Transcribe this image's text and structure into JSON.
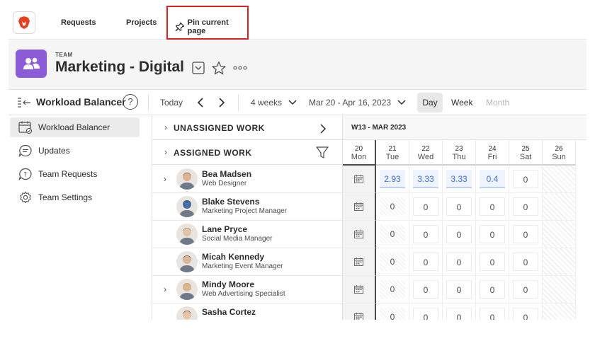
{
  "topnav": {
    "requests": "Requests",
    "projects": "Projects",
    "pin": "Pin current page",
    "logo_icon": "brave-lion-icon"
  },
  "header": {
    "label": "TEAM",
    "title": "Marketing - Digital",
    "accent": "#8b5cd6"
  },
  "toolbar": {
    "title": "Workload Balancer",
    "help": "?",
    "today": "Today",
    "range_select": "4 weeks",
    "date_range": "Mar 20 - Apr 16, 2023",
    "day": "Day",
    "week": "Week",
    "month": "Month"
  },
  "sidebar": {
    "items": [
      {
        "label": "Workload Balancer",
        "icon": "calendar-icon"
      },
      {
        "label": "Updates",
        "icon": "chat-icon"
      },
      {
        "label": "Team Requests",
        "icon": "question-bubble-icon"
      },
      {
        "label": "Team Settings",
        "icon": "gear-icon"
      }
    ]
  },
  "sections": {
    "unassigned": "UNASSIGNED WORK",
    "assigned": "ASSIGNED WORK"
  },
  "calendar": {
    "week_label": "W13 - MAR 2023",
    "days": [
      {
        "num": "20",
        "wd": "Mon"
      },
      {
        "num": "21",
        "wd": "Tue"
      },
      {
        "num": "22",
        "wd": "Wed"
      },
      {
        "num": "23",
        "wd": "Thu"
      },
      {
        "num": "24",
        "wd": "Fri"
      },
      {
        "num": "25",
        "wd": "Sat"
      },
      {
        "num": "26",
        "wd": "Sun"
      }
    ]
  },
  "people": [
    {
      "name": "Bea Madsen",
      "role": "Web Designer",
      "expandable": true,
      "values": [
        "2.93",
        "3.33",
        "3.33",
        "0.4",
        "0"
      ]
    },
    {
      "name": "Blake Stevens",
      "role": "Marketing Project Manager",
      "expandable": false,
      "values": [
        "0",
        "0",
        "0",
        "0",
        "0"
      ]
    },
    {
      "name": "Lane Pryce",
      "role": "Social Media Manager",
      "expandable": false,
      "values": [
        "0",
        "0",
        "0",
        "0",
        "0"
      ]
    },
    {
      "name": "Micah Kennedy",
      "role": "Marketing Event Manager",
      "expandable": false,
      "values": [
        "0",
        "0",
        "0",
        "0",
        "0"
      ]
    },
    {
      "name": "Mindy Moore",
      "role": "Web Advertising Specialist",
      "expandable": true,
      "values": [
        "0",
        "0",
        "0",
        "0",
        "0"
      ]
    },
    {
      "name": "Sasha Cortez",
      "role": "",
      "expandable": false,
      "values": [
        "0",
        "0",
        "0",
        "0",
        "0"
      ]
    }
  ]
}
